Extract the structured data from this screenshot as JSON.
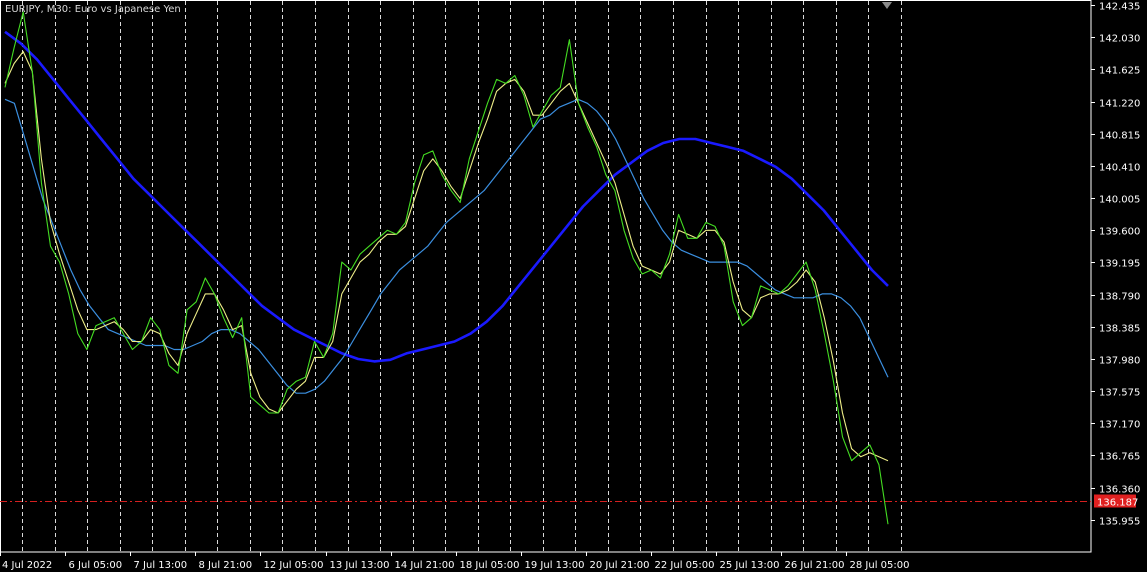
{
  "window": {
    "title": "EURJPY, M30:  Euro vs Japanese Yen"
  },
  "colors": {
    "background": "#000000",
    "axis": "#ffffff",
    "grid": "#ffffff",
    "price_line": "#44dd22",
    "ma_fast": "#eeee88",
    "ma_medium": "#3b8fe0",
    "ma_slow": "#1a1aff",
    "current_price_line": "#d42020",
    "current_price_badge": "#e02020"
  },
  "chart_data": {
    "type": "line",
    "symbol": "EURJPY",
    "timeframe": "M30",
    "title": "EURJPY, M30:  Euro vs Japanese Yen",
    "ylim": [
      135.55,
      142.5
    ],
    "y_ticks": [
      "142.435",
      "142.030",
      "141.625",
      "141.220",
      "140.815",
      "140.410",
      "140.005",
      "139.600",
      "139.195",
      "138.790",
      "138.385",
      "137.980",
      "137.575",
      "137.170",
      "136.765",
      "136.360",
      "135.955"
    ],
    "x_ticks": [
      "4 Jul 2022",
      "6 Jul 05:00",
      "7 Jul 13:00",
      "8 Jul 21:00",
      "12 Jul 05:00",
      "13 Jul 13:00",
      "14 Jul 21:00",
      "18 Jul 05:00",
      "19 Jul 13:00",
      "20 Jul 21:00",
      "22 Jul 05:00",
      "25 Jul 13:00",
      "26 Jul 21:00",
      "28 Jul 05:00"
    ],
    "grid": "vertical dashed",
    "current_price": "136.187",
    "series": [
      {
        "role": "price",
        "values": [
          141.4,
          141.9,
          142.35,
          141.6,
          140.2,
          139.4,
          139.2,
          138.8,
          138.3,
          138.1,
          138.4,
          138.45,
          138.5,
          138.3,
          138.1,
          138.2,
          138.5,
          138.35,
          137.9,
          137.8,
          138.6,
          138.7,
          139.0,
          138.8,
          138.5,
          138.25,
          138.5,
          137.5,
          137.4,
          137.3,
          137.3,
          137.6,
          137.7,
          137.75,
          138.2,
          138.0,
          138.3,
          139.2,
          139.1,
          139.3,
          139.4,
          139.5,
          139.6,
          139.55,
          139.7,
          140.2,
          140.55,
          140.6,
          140.3,
          140.1,
          139.95,
          140.5,
          140.85,
          141.2,
          141.5,
          141.45,
          141.55,
          141.3,
          140.9,
          141.1,
          141.3,
          141.4,
          142.0,
          141.2,
          140.9,
          140.65,
          140.3,
          140.1,
          139.6,
          139.25,
          139.05,
          139.1,
          139.0,
          139.3,
          139.8,
          139.5,
          139.5,
          139.7,
          139.65,
          139.4,
          138.7,
          138.4,
          138.5,
          138.9,
          138.85,
          138.8,
          138.9,
          139.05,
          139.2,
          138.85,
          138.3,
          137.7,
          137.0,
          136.7,
          136.8,
          136.9,
          136.65,
          135.9
        ]
      },
      {
        "role": "fast moving average",
        "values": [
          141.45,
          141.7,
          141.85,
          141.6,
          140.5,
          139.7,
          139.3,
          138.95,
          138.6,
          138.35,
          138.35,
          138.4,
          138.45,
          138.35,
          138.2,
          138.2,
          138.35,
          138.3,
          138.05,
          137.9,
          138.3,
          138.55,
          138.8,
          138.8,
          138.6,
          138.35,
          138.4,
          137.8,
          137.5,
          137.35,
          137.3,
          137.45,
          137.6,
          137.7,
          138.0,
          138.0,
          138.2,
          138.8,
          139.0,
          139.2,
          139.3,
          139.45,
          139.55,
          139.55,
          139.65,
          140.0,
          140.35,
          140.5,
          140.35,
          140.15,
          140.0,
          140.35,
          140.7,
          141.0,
          141.35,
          141.45,
          141.5,
          141.35,
          141.05,
          141.05,
          141.2,
          141.35,
          141.45,
          141.2,
          140.95,
          140.7,
          140.45,
          140.2,
          139.8,
          139.4,
          139.15,
          139.1,
          139.05,
          139.2,
          139.6,
          139.55,
          139.5,
          139.6,
          139.6,
          139.45,
          138.95,
          138.6,
          138.5,
          138.75,
          138.8,
          138.8,
          138.85,
          138.95,
          139.1,
          138.95,
          138.5,
          137.95,
          137.3,
          136.85,
          136.75,
          136.8,
          136.75,
          136.7
        ]
      },
      {
        "role": "medium moving average",
        "values": [
          141.25,
          141.2,
          140.8,
          140.4,
          140.0,
          139.7,
          139.4,
          139.1,
          138.85,
          138.65,
          138.5,
          138.35,
          138.3,
          138.25,
          138.2,
          138.15,
          138.15,
          138.15,
          138.1,
          138.1,
          138.15,
          138.2,
          138.3,
          138.35,
          138.35,
          138.3,
          138.2,
          138.1,
          137.95,
          137.8,
          137.65,
          137.55,
          137.55,
          137.6,
          137.7,
          137.85,
          138.0,
          138.2,
          138.4,
          138.6,
          138.8,
          138.95,
          139.1,
          139.2,
          139.3,
          139.4,
          139.55,
          139.7,
          139.8,
          139.9,
          140.0,
          140.1,
          140.25,
          140.4,
          140.55,
          140.7,
          140.85,
          141.0,
          141.05,
          141.15,
          141.2,
          141.25,
          141.2,
          141.1,
          140.95,
          140.75,
          140.5,
          140.25,
          140.0,
          139.8,
          139.6,
          139.45,
          139.35,
          139.3,
          139.25,
          139.2,
          139.2,
          139.2,
          139.2,
          139.15,
          139.05,
          138.95,
          138.85,
          138.8,
          138.75,
          138.75,
          138.75,
          138.8,
          138.8,
          138.75,
          138.65,
          138.5,
          138.25,
          138.0,
          137.75
        ]
      },
      {
        "role": "slow moving average",
        "values": [
          142.1,
          141.95,
          141.75,
          141.5,
          141.25,
          141.0,
          140.75,
          140.5,
          140.25,
          140.05,
          139.85,
          139.65,
          139.45,
          139.25,
          139.05,
          138.85,
          138.65,
          138.5,
          138.35,
          138.25,
          138.15,
          138.05,
          137.98,
          137.95,
          137.97,
          138.05,
          138.1,
          138.15,
          138.2,
          138.3,
          138.45,
          138.65,
          138.9,
          139.15,
          139.4,
          139.65,
          139.9,
          140.1,
          140.3,
          140.45,
          140.6,
          140.7,
          140.75,
          140.75,
          140.7,
          140.65,
          140.6,
          140.5,
          140.4,
          140.25,
          140.05,
          139.85,
          139.6,
          139.35,
          139.1,
          138.9
        ]
      }
    ]
  }
}
